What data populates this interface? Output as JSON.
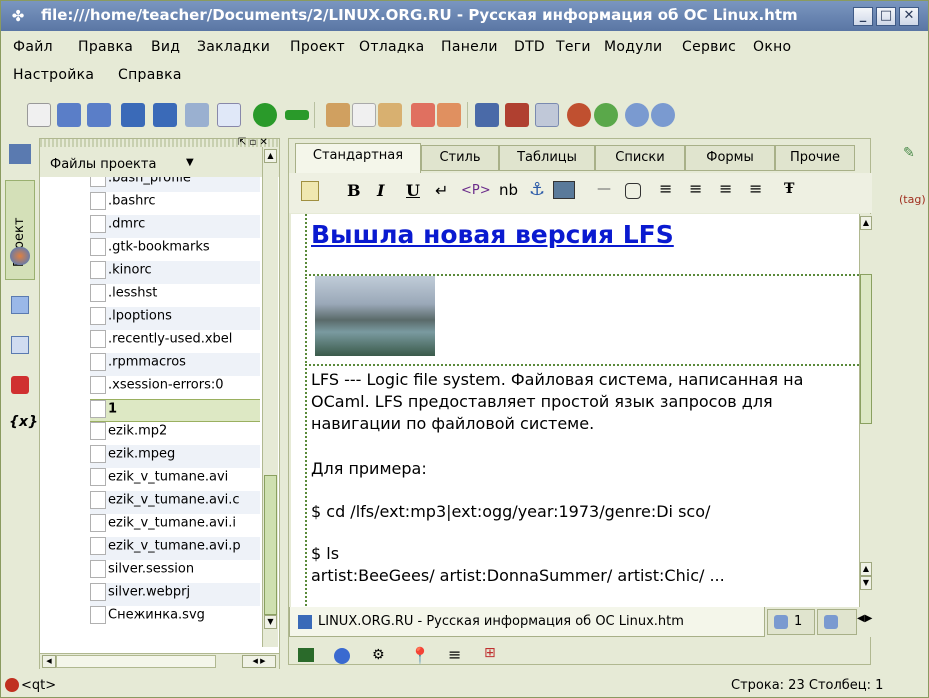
{
  "window": {
    "title": "file:///home/teacher/Documents/2/LINUX.ORG.RU - Русская информация об ОС Linux.htm",
    "app_icon": "quanta-icon",
    "controls": {
      "minimize": "_",
      "maximize": "□",
      "close": "✕"
    }
  },
  "menu": {
    "row1": [
      "Файл",
      "Правка",
      "Вид",
      "Закладки",
      "Проект",
      "Отладка",
      "Панели",
      "DTD",
      "Теги",
      "Модули",
      "Сервис",
      "Окно"
    ],
    "row2": [
      "Настройка",
      "Справка"
    ]
  },
  "left_tabs": {
    "project_label": "Проект"
  },
  "project_panel": {
    "header": "Файлы проекта",
    "files": [
      ".bash_profile",
      ".bashrc",
      ".dmrc",
      ".gtk-bookmarks",
      ".kinorc",
      ".lesshst",
      ".lpoptions",
      ".recently-used.xbel",
      ".rpmmacros",
      ".xsession-errors:0",
      "1",
      "ezik.mp2",
      "ezik.mpeg",
      "ezik_v_tumane.avi",
      "ezik_v_tumane.avi.c",
      "ezik_v_tumane.avi.i",
      "ezik_v_tumane.avi.p",
      "silver.session",
      "silver.webprj",
      "Снежинка.svg"
    ],
    "selected_index": 10
  },
  "editor": {
    "tabs": [
      "Стандартная",
      "Стиль",
      "Таблицы",
      "Списки",
      "Формы",
      "Прочие"
    ],
    "active_tab": 0,
    "format": {
      "bold": "B",
      "italic": "I",
      "underline": "U",
      "p": "<P>",
      "nbsp": "nb"
    },
    "content": {
      "heading": "Вышла новая версия LFS",
      "para1": "LFS --- Logic file system. Файловая система, написанная на OCaml. LFS предоставляет простой язык запросов для навигации по файловой системе.",
      "para2": "Для примера:",
      "para3": "$ cd /lfs/ext:mp3|ext:ogg/year:1973/genre:Di sco/",
      "para4a": "$ ls",
      "para4b": "artist:BeeGees/ artist:DonnaSummer/ artist:Chic/ ..."
    },
    "doc_tabs": [
      "LINUX.ORG.RU - Русская информация об ОС Linux.htm",
      "1"
    ]
  },
  "status": {
    "left": "<qt>",
    "right": "Строка: 23 Столбец: 1"
  },
  "right_side": {
    "tag_label": "(tag)"
  }
}
